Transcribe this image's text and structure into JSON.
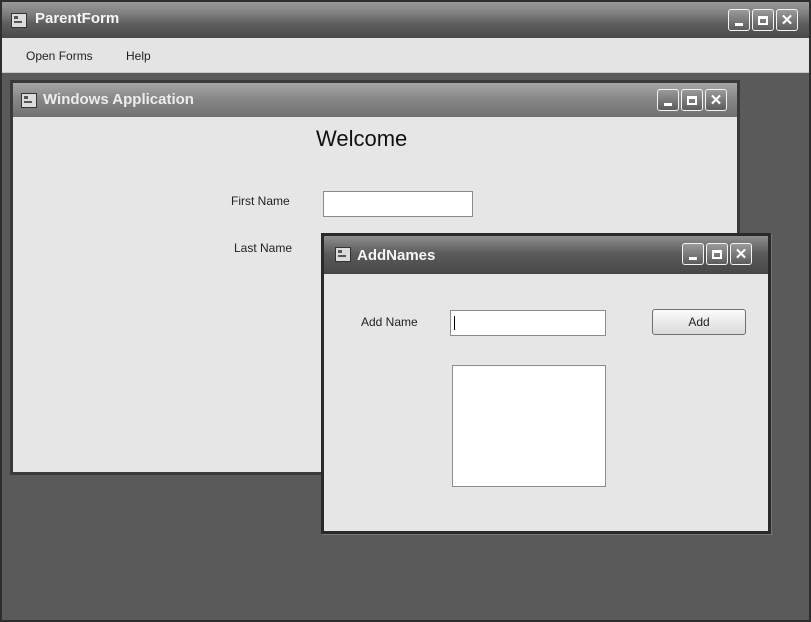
{
  "parent_window": {
    "title": "ParentForm",
    "menu": [
      {
        "label": "Open Forms"
      },
      {
        "label": "Help"
      }
    ]
  },
  "mdi_child": {
    "title": "Windows Application",
    "heading": "Welcome",
    "first_name_label": "First Name",
    "first_name_value": "",
    "last_name_label": "Last Name"
  },
  "dialog": {
    "title": "AddNames",
    "add_name_label": "Add Name",
    "add_name_value": "",
    "add_button_label": "Add",
    "names_list": []
  },
  "colors": {
    "mdi_background": "#5a5a5a",
    "form_background": "#e6e6e6"
  }
}
